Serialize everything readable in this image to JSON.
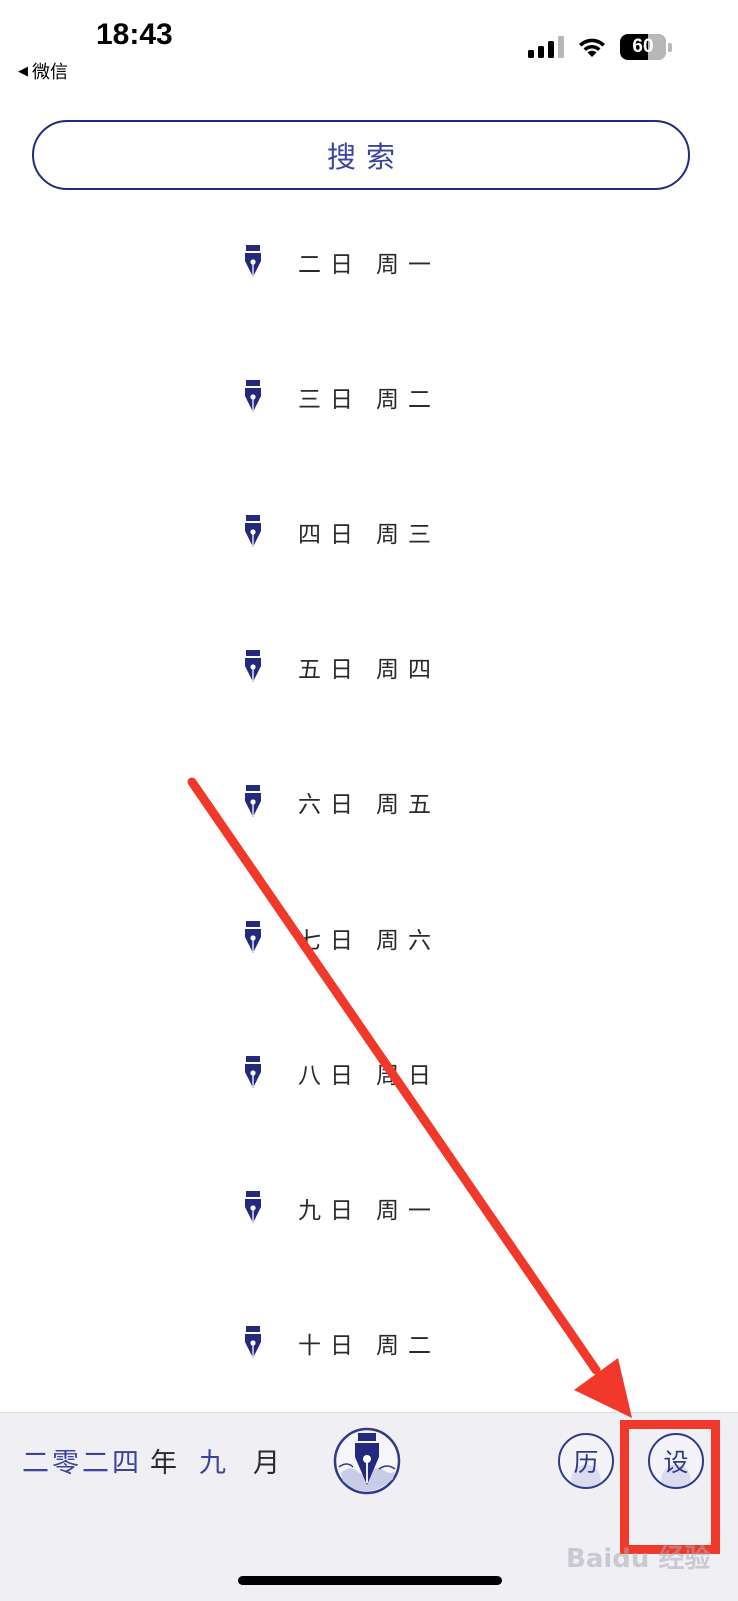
{
  "status_bar": {
    "time": "18:43",
    "back_app": "微信",
    "battery": "60"
  },
  "search": {
    "label": "搜索"
  },
  "dates": [
    {
      "day": "二日",
      "weekday": "周一"
    },
    {
      "day": "三日",
      "weekday": "周二"
    },
    {
      "day": "四日",
      "weekday": "周三"
    },
    {
      "day": "五日",
      "weekday": "周四"
    },
    {
      "day": "六日",
      "weekday": "周五"
    },
    {
      "day": "七日",
      "weekday": "周六"
    },
    {
      "day": "八日",
      "weekday": "周日"
    },
    {
      "day": "九日",
      "weekday": "周一"
    },
    {
      "day": "十日",
      "weekday": "周二"
    }
  ],
  "bottom_bar": {
    "year": "二零二四",
    "year_unit": "年",
    "month": "九",
    "month_unit": "月",
    "history_label": "历",
    "settings_label": "设"
  },
  "watermark": "Baidu 经验",
  "colors": {
    "accent": "#2e3a8c",
    "annotation": "#f0392b",
    "bottom_bar_bg": "#f0eff3"
  },
  "icons": {
    "row_icon": "fountain-pen-nib-icon",
    "center_icon": "fountain-pen-emblem-icon"
  }
}
